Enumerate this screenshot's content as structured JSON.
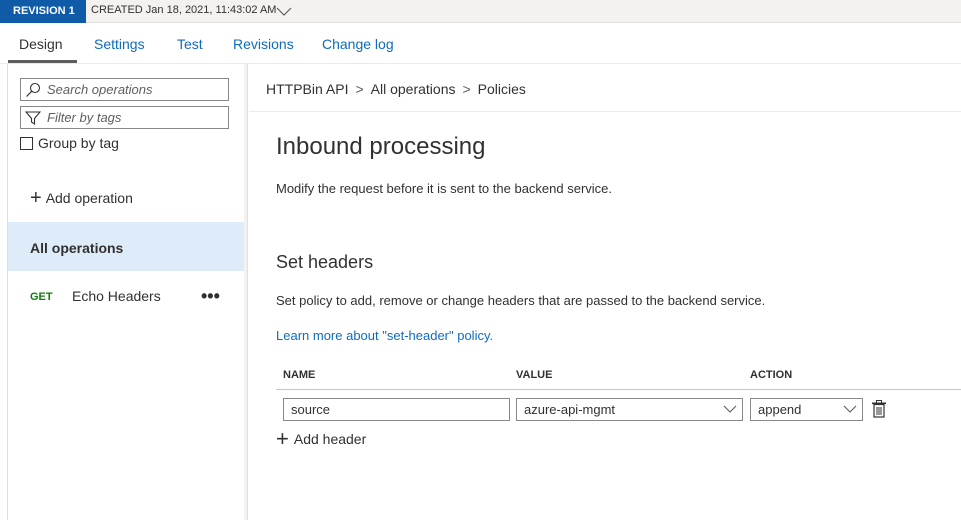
{
  "revision": {
    "badge": "REVISION 1",
    "created": "CREATED Jan 18, 2021, 11:43:02 AM"
  },
  "tabs": [
    {
      "label": "Design",
      "active": true
    },
    {
      "label": "Settings",
      "active": false
    },
    {
      "label": "Test",
      "active": false
    },
    {
      "label": "Revisions",
      "active": false
    },
    {
      "label": "Change log",
      "active": false
    }
  ],
  "sidebar": {
    "search_placeholder": "Search operations",
    "filter_placeholder": "Filter by tags",
    "group_by_tag": "Group by tag",
    "add_operation": "Add operation",
    "all_operations": "All operations",
    "operations": [
      {
        "method": "GET",
        "name": "Echo Headers",
        "more": "•••"
      }
    ]
  },
  "breadcrumb": [
    "HTTPBin API",
    "All operations",
    "Policies"
  ],
  "breadcrumb_sep": ">",
  "main": {
    "title": "Inbound processing",
    "description": "Modify the request before it is sent to the backend service.",
    "section_title": "Set headers",
    "section_description": "Set policy to add, remove or change headers that are passed to the backend service.",
    "learn_more": "Learn more about \"set-header\" policy."
  },
  "headers_table": {
    "columns": [
      "NAME",
      "VALUE",
      "ACTION"
    ],
    "rows": [
      {
        "name": "source",
        "value": "azure-api-mgmt",
        "action": "append"
      }
    ],
    "add_label": "Add header"
  },
  "colors": {
    "accent": "#0f6cbd",
    "revision_badge": "#0f5ba8",
    "selected_bg": "#deecf9",
    "get_method": "#107c10"
  }
}
